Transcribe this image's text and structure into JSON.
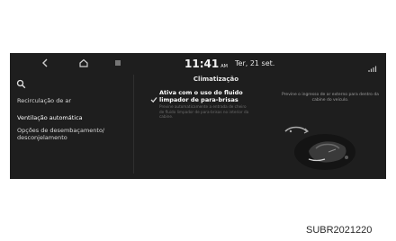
{
  "topbar": {
    "back_icon": "back-chevron-icon",
    "home_icon": "home-icon",
    "menu_icon": "menu-icon",
    "time": "11:41",
    "ampm": "AM",
    "date": "Ter, 21 set.",
    "status_icon": "signal-icon"
  },
  "sidebar": {
    "search_icon": "search-icon",
    "items": [
      {
        "label": "Recirculação de ar"
      },
      {
        "label": "Ventilação automática"
      },
      {
        "label": "Opções de desembaçamento/ desconjelamento"
      }
    ]
  },
  "main": {
    "title": "Climatização",
    "option": {
      "checked": true,
      "label": "Ativa com o uso do fluido limpador de para-brisas",
      "description": "Previne automaticamente a entrada de cheiro de fluido limpador de para-brisas no interior da cabine."
    },
    "info_text": "Previne o ingresso de ar externo para dentro da cabine do veículo."
  },
  "caption": "SUBR2021220"
}
